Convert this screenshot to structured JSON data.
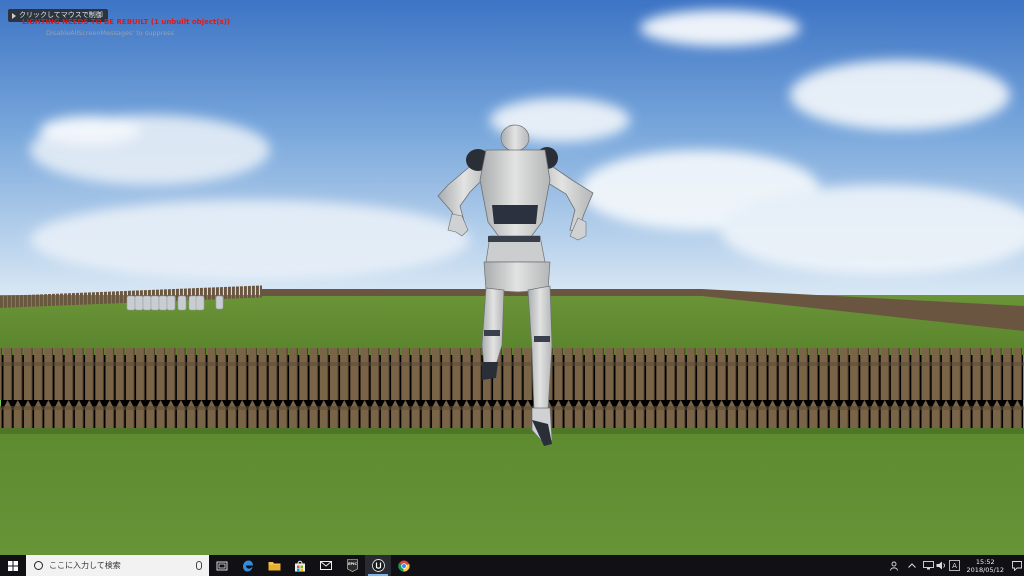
{
  "viewport": {
    "click_hint": "クリックしてマウスで制御",
    "warning": "LIGHTING NEEDS TO BE REBUILT (1 unbuilt object(s))",
    "suppress_hint": "DisableAllScreenMessages' to suppress"
  },
  "taskbar": {
    "search_placeholder": "ここに入力して検索",
    "apps": [
      "task-view",
      "edge",
      "file-explorer",
      "store",
      "mail",
      "epic-games",
      "unreal-engine",
      "chrome"
    ],
    "epic_label": "EPIC",
    "clock": {
      "time": "15:52",
      "date": "2018/05/12"
    }
  },
  "colors": {
    "sky_top": "#3f78c8",
    "grass": "#5f8a2f",
    "fence": "#6e5a43",
    "taskbar": "#101015"
  }
}
